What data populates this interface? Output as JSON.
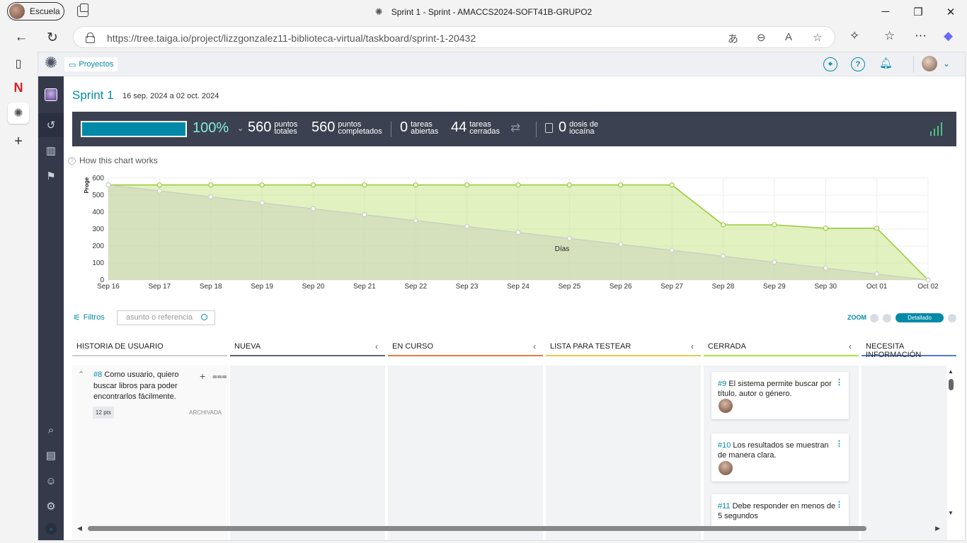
{
  "browser": {
    "profile_label": "Escuela",
    "window_title": "Sprint 1 - Sprint - AMACCS2024-SOFT41B-GRUPO2",
    "url": "https://tree.taiga.io/project/lizzgonzalez11-biblioteca-virtual/taskboard/sprint-1-20432"
  },
  "topnav": {
    "projects_label": "Proyectos"
  },
  "sprint": {
    "title": "Sprint 1",
    "dates": "16 sep. 2024 a 02 oct. 2024"
  },
  "stats": {
    "progress_percent": 100,
    "percent_label": "100%",
    "total_points": "560",
    "total_points_label": [
      "puntos",
      "totales"
    ],
    "completed_points": "560",
    "completed_points_label": [
      "puntos",
      "completados"
    ],
    "open_tasks": "0",
    "open_tasks_label": [
      "tareas",
      "abiertas"
    ],
    "closed_tasks": "44",
    "closed_tasks_label": [
      "tareas",
      "cerradas"
    ],
    "iocaine": "0",
    "iocaine_label": [
      "dosis de",
      "iocaína"
    ]
  },
  "chart_link": "How this chart works",
  "chart_data": {
    "type": "area",
    "xlabel": "Días",
    "ylabel": "Proge",
    "ylim": [
      0,
      600
    ],
    "yticks": [
      0,
      100,
      200,
      300,
      400,
      500,
      600
    ],
    "categories": [
      "Sep 16",
      "Sep 17",
      "Sep 18",
      "Sep 19",
      "Sep 20",
      "Sep 21",
      "Sep 22",
      "Sep 23",
      "Sep 24",
      "Sep 25",
      "Sep 26",
      "Sep 27",
      "Sep 28",
      "Sep 29",
      "Sep 30",
      "Oct 01",
      "Oct 02"
    ],
    "series": [
      {
        "values": [
          560,
          560,
          560,
          560,
          560,
          560,
          560,
          560,
          560,
          560,
          560,
          560,
          325,
          325,
          305,
          305,
          0
        ],
        "color": "#9ccc3c"
      },
      {
        "values": [
          560,
          525,
          490,
          455,
          420,
          385,
          350,
          315,
          280,
          245,
          210,
          175,
          140,
          105,
          70,
          35,
          0
        ],
        "color": "#c9cdbf"
      }
    ]
  },
  "filters": {
    "label": "Filtros",
    "search_placeholder": "asunto o referencia",
    "zoom_label": "ZOOM",
    "zoom_selected": "Detallado"
  },
  "board": {
    "columns": [
      {
        "label": "HISTORIA DE USUARIO",
        "color": "#cccccc"
      },
      {
        "label": "NUEVA",
        "color": "#5e6177"
      },
      {
        "label": "EN CURSO",
        "color": "#e47c40"
      },
      {
        "label": "LISTA PARA TESTEAR",
        "color": "#e5c94c"
      },
      {
        "label": "CERRADA",
        "color": "#a8e440"
      },
      {
        "label": "NECESITA INFORMACIÓN",
        "color": "#5178d3"
      }
    ],
    "user_story": {
      "ref": "#8",
      "text": "Como usuario, quiero buscar libros para poder encontrarlos fácilmente.",
      "points": "12 pts",
      "status": "ARCHIVADA"
    },
    "cards": [
      {
        "ref": "#9",
        "text": "El sistema permite buscar por título, autor o género."
      },
      {
        "ref": "#10",
        "text": "Los resultados se muestran de manera clara."
      },
      {
        "ref": "#11",
        "text": "Debe responder en menos de 5 segundos"
      }
    ]
  }
}
